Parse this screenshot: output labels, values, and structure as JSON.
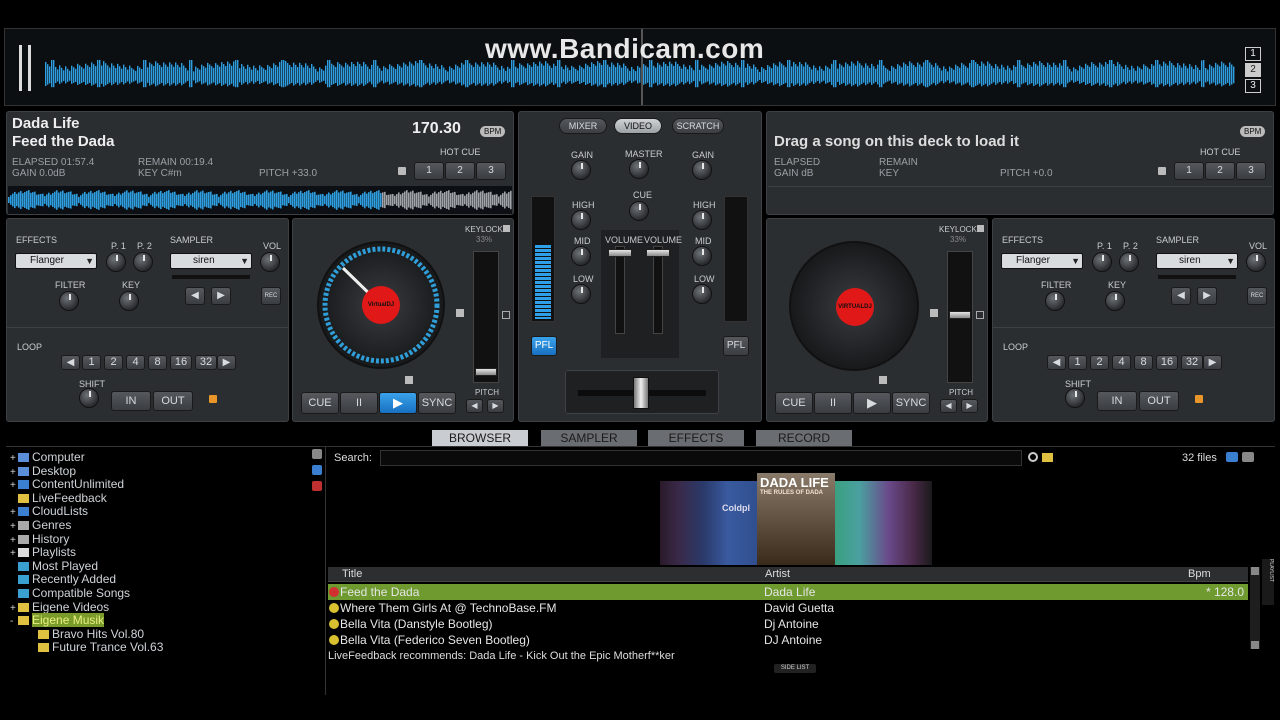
{
  "watermark": "www.Bandicam.com",
  "waveform_deck_numbers": [
    "1",
    "2",
    "3"
  ],
  "deck_left": {
    "artist": "Dada Life",
    "title": "Feed the Dada",
    "bpm": "170.30",
    "bpm_label": "BPM",
    "elapsed": "ELAPSED 01:57.4",
    "remain": "REMAIN 00:19.4",
    "gain": "GAIN 0.0dB",
    "key": "KEY C#m",
    "pitch": "PITCH +33.0",
    "hot_cue_label": "HOT CUE",
    "hot_cues": [
      "1",
      "2",
      "3"
    ],
    "effects_label": "EFFECTS",
    "effect": "Flanger",
    "p1": "P. 1",
    "p2": "P. 2",
    "sampler_label": "SAMPLER",
    "sample": "siren",
    "vol": "VOL",
    "rec": "REC",
    "filter": "FILTER",
    "key_knob": "KEY",
    "loop_label": "LOOP",
    "loops": [
      "1",
      "2",
      "4",
      "8",
      "16",
      "32"
    ],
    "shift": "SHIFT",
    "in": "IN",
    "out": "OUT",
    "keylock": "KEYLOCK",
    "keylock_pct": "33%",
    "pitch_label": "PITCH",
    "transport": [
      "CUE",
      "II",
      "▶",
      "SYNC"
    ],
    "platter_logo": "VirtualDJ",
    "progress": 0.86
  },
  "deck_right": {
    "message": "Drag a song on this deck to load it",
    "bpm_label": "BPM",
    "elapsed": "ELAPSED",
    "remain": "REMAIN",
    "gain": "GAIN dB",
    "key": "KEY",
    "pitch": "PITCH +0.0",
    "hot_cue_label": "HOT CUE",
    "hot_cues": [
      "1",
      "2",
      "3"
    ],
    "effects_label": "EFFECTS",
    "effect": "Flanger",
    "p1": "P. 1",
    "p2": "P. 2",
    "sampler_label": "SAMPLER",
    "sample": "siren",
    "vol": "VOL",
    "rec": "REC",
    "filter": "FILTER",
    "key_knob": "KEY",
    "loop_label": "LOOP",
    "loops": [
      "1",
      "2",
      "4",
      "8",
      "16",
      "32"
    ],
    "shift": "SHIFT",
    "in": "IN",
    "out": "OUT",
    "keylock": "KEYLOCK",
    "keylock_pct": "33%",
    "pitch_label": "PITCH",
    "transport": [
      "CUE",
      "II",
      "▶",
      "SYNC"
    ],
    "platter_logo": "VIRTUALDJ"
  },
  "mixer": {
    "tabs": [
      "MIXER",
      "VIDEO",
      "SCRATCH"
    ],
    "gain": "GAIN",
    "master": "MASTER",
    "cue": "CUE",
    "high": "HIGH",
    "mid": "MID",
    "low": "LOW",
    "volume": "VOLUME",
    "pfl": "PFL"
  },
  "browser_tabs": [
    "BROWSER",
    "SAMPLER",
    "EFFECTS",
    "RECORD"
  ],
  "tree": [
    {
      "label": "Computer",
      "prefix": "+",
      "color": "#5b8fd8"
    },
    {
      "label": "Desktop",
      "prefix": "+",
      "color": "#5b8fd8"
    },
    {
      "label": "ContentUnlimited",
      "prefix": "+",
      "color": "#3a7fd0"
    },
    {
      "label": "LiveFeedback",
      "prefix": "",
      "color": "#e0c040"
    },
    {
      "label": "CloudLists",
      "prefix": "+",
      "color": "#3a7fd0"
    },
    {
      "label": "Genres",
      "prefix": "+",
      "color": "#aaaaaa"
    },
    {
      "label": "History",
      "prefix": "+",
      "color": "#aaaaaa"
    },
    {
      "label": "Playlists",
      "prefix": "+",
      "color": "#dddddd"
    },
    {
      "label": "Most Played",
      "prefix": "",
      "color": "#3aa0d0"
    },
    {
      "label": "Recently Added",
      "prefix": "",
      "color": "#3aa0d0"
    },
    {
      "label": "Compatible Songs",
      "prefix": "",
      "color": "#3aa0d0"
    },
    {
      "label": "Eigene Videos",
      "prefix": "+",
      "color": "#e0c040"
    },
    {
      "label": "Eigene Musik",
      "prefix": "-",
      "color": "#e0c040",
      "selected": true
    },
    {
      "label": "Bravo Hits Vol.80",
      "prefix": "",
      "color": "#e0c040",
      "indent": true
    },
    {
      "label": "Future Trance Vol.63",
      "prefix": "",
      "color": "#e0c040",
      "indent": true
    }
  ],
  "search_label": "Search:",
  "search_value": "",
  "file_count": "32 files",
  "album": {
    "line1": "DADA LIFE",
    "line2": "THE RULES OF DADA",
    "neighbor": "Coldpl"
  },
  "columns": {
    "title": "Title",
    "artist": "Artist",
    "bpm": "Bpm"
  },
  "tracks": [
    {
      "title": "Feed the Dada",
      "artist": "Dada Life",
      "bpm": "* 128.0",
      "active": true
    },
    {
      "title": "Where Them Girls At @ TechnoBase.FM",
      "artist": "David Guetta",
      "bpm": ""
    },
    {
      "title": "Bella Vita (Danstyle Bootleg)",
      "artist": "Dj Antoine",
      "bpm": ""
    },
    {
      "title": "Bella Vita (Federico Seven Bootleg)",
      "artist": "DJ Antoine",
      "bpm": ""
    }
  ],
  "live_feedback": "LiveFeedback recommends: Dada Life - Kick Out the Epic Motherf**ker",
  "side_list": "SIDE LIST",
  "playlist_tab": "PLAYLIST"
}
